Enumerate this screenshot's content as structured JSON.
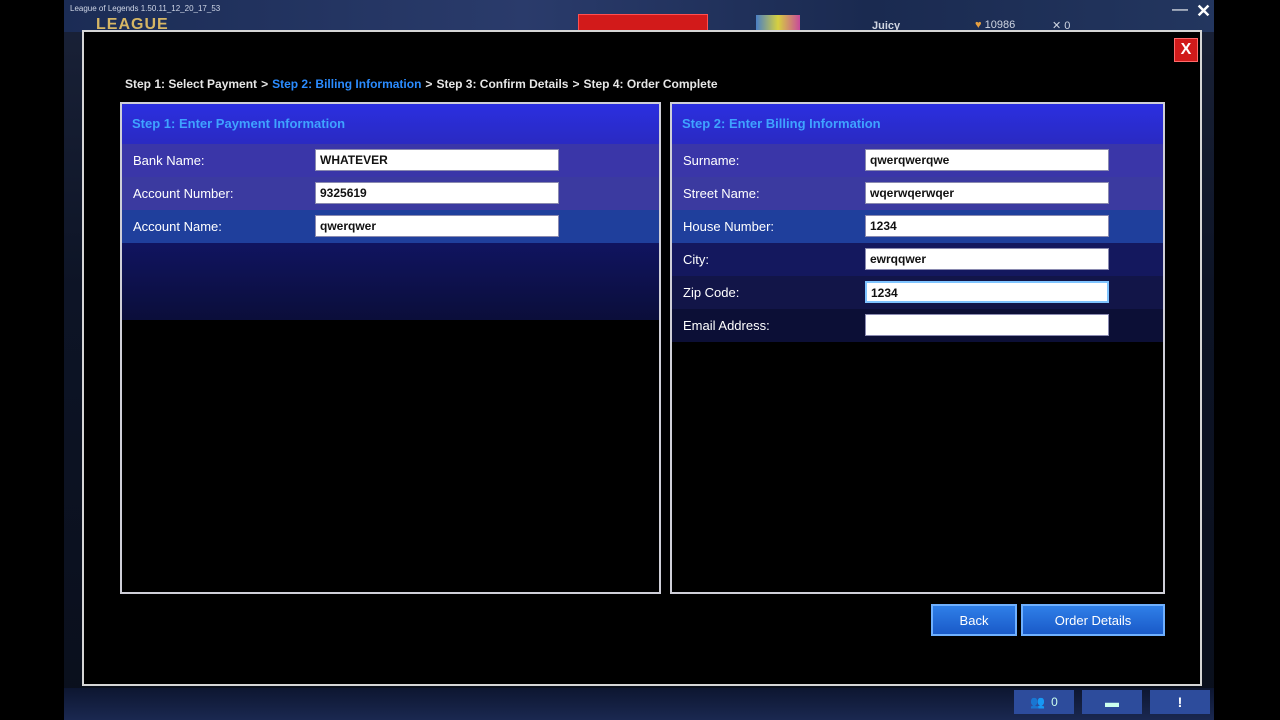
{
  "background": {
    "window_title": "League of Legends 1.50.11_12_20_17_53",
    "logo_text": "LEAGUE",
    "username": "Juicy",
    "ip_value": "10986",
    "rp_value": "0",
    "friends_count": "0",
    "minimize_glyph": "—",
    "close_glyph": "✕"
  },
  "modal": {
    "close_label": "X",
    "steps": [
      {
        "label": "Step 1: Select Payment",
        "active": false
      },
      {
        "label": "Step 2: Billing Information",
        "active": true
      },
      {
        "label": "Step 3: Confirm Details",
        "active": false
      },
      {
        "label": "Step 4: Order Complete",
        "active": false
      }
    ],
    "step_separator": ">",
    "payment_panel": {
      "title": "Step 1: Enter Payment Information",
      "fields": [
        {
          "label": "Bank Name:",
          "value": "WHATEVER"
        },
        {
          "label": "Account Number:",
          "value": "9325619"
        },
        {
          "label": "Account Name:",
          "value": "qwerqwer"
        }
      ]
    },
    "billing_panel": {
      "title": "Step 2: Enter Billing Information",
      "fields": [
        {
          "label": "Surname:",
          "value": "qwerqwerqwe"
        },
        {
          "label": "Street Name:",
          "value": "wqerwqerwqer"
        },
        {
          "label": "House Number:",
          "value": "1234"
        },
        {
          "label": "City:",
          "value": "ewrqqwer"
        },
        {
          "label": "Zip Code:",
          "value": "1234"
        },
        {
          "label": "Email Address:",
          "value": ""
        }
      ]
    },
    "buttons": {
      "back": "Back",
      "order_details": "Order Details"
    }
  },
  "colors": {
    "accent_blue": "#2b8cff",
    "close_red": "#d11b1b",
    "panel_header": "#2b2fe0"
  }
}
